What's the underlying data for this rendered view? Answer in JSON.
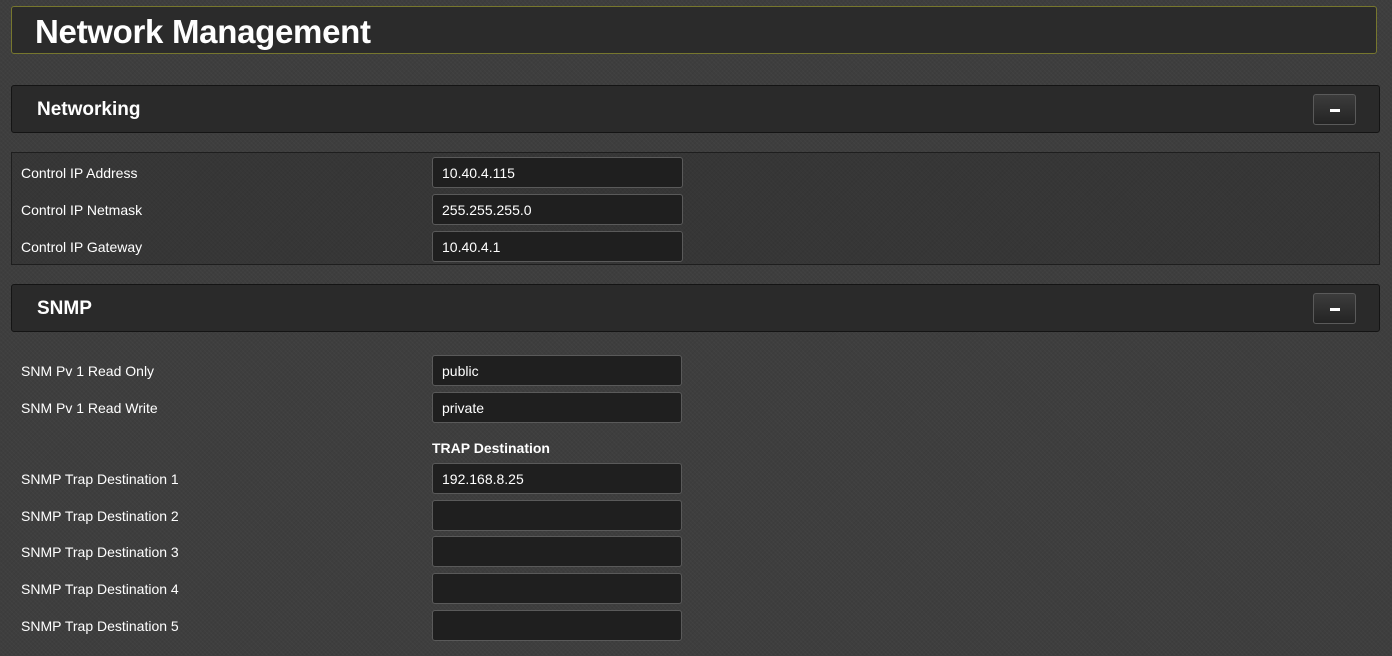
{
  "header": {
    "title": "Network Management"
  },
  "networking": {
    "title": "Networking",
    "collapse_label": "−",
    "rows": [
      {
        "label": "Control IP Address",
        "value": "10.40.4.115"
      },
      {
        "label": "Control IP Netmask",
        "value": "255.255.255.0"
      },
      {
        "label": "Control IP Gateway",
        "value": "10.40.4.1"
      }
    ]
  },
  "snmp": {
    "title": "SNMP",
    "collapse_label": "−",
    "rows": [
      {
        "label": "SNM Pv 1 Read Only",
        "value": "public"
      },
      {
        "label": "SNM Pv 1 Read Write",
        "value": "private"
      }
    ],
    "trap_header": "TRAP Destination",
    "traps": [
      {
        "label": "SNMP Trap Destination 1",
        "value": "192.168.8.25"
      },
      {
        "label": "SNMP Trap Destination 2",
        "value": ""
      },
      {
        "label": "SNMP Trap Destination 3",
        "value": ""
      },
      {
        "label": "SNMP Trap Destination 4",
        "value": ""
      },
      {
        "label": "SNMP Trap Destination 5",
        "value": ""
      }
    ]
  }
}
